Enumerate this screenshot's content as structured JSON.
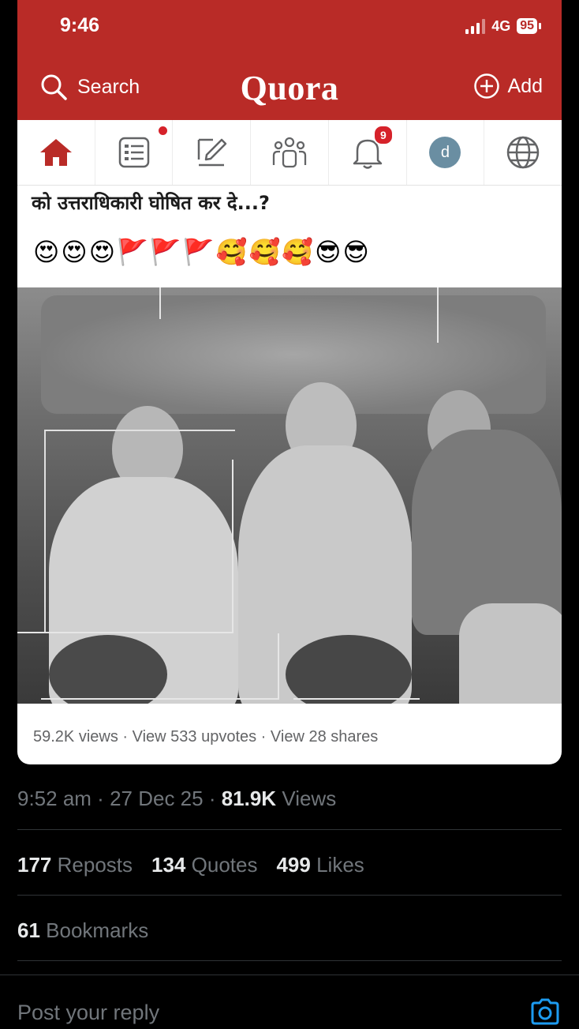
{
  "status_bar": {
    "time": "9:46",
    "network": "4G",
    "battery": "95"
  },
  "header": {
    "search_label": "Search",
    "logo": "Quora",
    "add_label": "Add"
  },
  "nav": {
    "notifications_count": "9",
    "avatar_letter": "d",
    "icons": [
      "home-icon",
      "answer-icon",
      "write-icon",
      "spaces-icon",
      "bell-icon",
      "avatar",
      "globe-icon"
    ]
  },
  "post": {
    "text": "को उत्तराधिकारी घोषित कर दे...?",
    "emojis": "😍😍😍🚩🚩🚩🥰🥰🥰😎😎",
    "stats": "59.2K views · View 533 upvotes · View 28 shares"
  },
  "tweet_meta": {
    "time": "9:52 am",
    "date": "27 Dec 25",
    "views_count": "81.9K",
    "views_label": "Views",
    "separator": " · "
  },
  "engagement": {
    "reposts_count": "177",
    "reposts_label": "Reposts",
    "quotes_count": "134",
    "quotes_label": "Quotes",
    "likes_count": "499",
    "likes_label": "Likes",
    "bookmarks_count": "61",
    "bookmarks_label": "Bookmarks"
  },
  "reply": {
    "placeholder": "Post your reply"
  },
  "colors": {
    "quora_red": "#b92b27",
    "badge_red": "#d6222a",
    "background": "#000000",
    "muted": "#71767b"
  }
}
